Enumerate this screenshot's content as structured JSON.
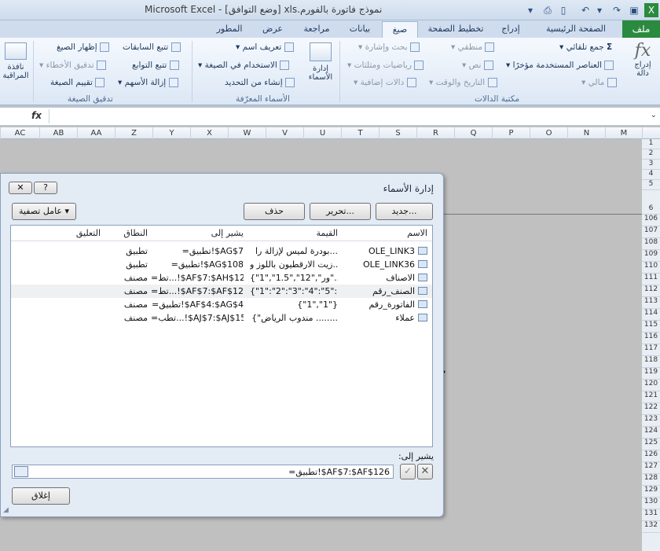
{
  "window": {
    "title": "نموذج فاتورة بالفورم.xls  [وضع التوافق] - Microsoft Excel"
  },
  "ribbon_tabs": [
    {
      "label": "ملف"
    },
    {
      "label": "الصفحة الرئيسية"
    },
    {
      "label": "إدراج"
    },
    {
      "label": "تخطيط الصفحة"
    },
    {
      "label": "صيغ"
    },
    {
      "label": "بيانات"
    },
    {
      "label": "مراجعة"
    },
    {
      "label": "عرض"
    },
    {
      "label": "المطور"
    }
  ],
  "ribbon": {
    "insert_function": "إدراج دالة",
    "autosum": "جمع تلقائي",
    "recently_used": "العناصر المستخدمة مؤخرًا",
    "financial": "مالي",
    "logical": "منطقي",
    "text": "نص",
    "date_time": "التاريخ والوقت",
    "lookup": "بحث وإشارة",
    "math_trig": "رياضيات ومثلثات",
    "more_functions": "دالات إضافية",
    "function_library": "مكتبة الدالات",
    "name_manager": "إدارة الأسماء",
    "define_name": "تعريف اسم",
    "use_in_formula": "الاستخدام في الصيغة",
    "create_from_selection": "إنشاء من التحديد",
    "defined_names": "الأسماء المعرّفة",
    "trace_precedents": "تتبع السابقات",
    "trace_dependents": "تتبع التوابع",
    "remove_arrows": "إزالة الأسهم",
    "show_formulas": "إظهار الصيغ",
    "error_checking": "تدقيق الأخطاء",
    "evaluate_formula": "تقييم الصيغة",
    "formula_auditing": "تدقيق الصيغة",
    "watch_window": "نافذة المراقبة"
  },
  "formula_bar": {
    "fx": "fx",
    "value": ""
  },
  "columns": [
    "AC",
    "AB",
    "AA",
    "Z",
    "Y",
    "X",
    "W",
    "V",
    "U",
    "T",
    "S",
    "R",
    "Q",
    "P",
    "O",
    "N",
    "M"
  ],
  "rows": [
    "1",
    "2",
    "3",
    "4",
    "5",
    "6",
    "106",
    "107",
    "108",
    "109",
    "110",
    "111",
    "112",
    "113",
    "114",
    "115",
    "116",
    "117",
    "118",
    "119",
    "120",
    "121",
    "122",
    "123",
    "124",
    "125",
    "126",
    "127",
    "128",
    "129",
    "130",
    "131",
    "132"
  ],
  "dialog": {
    "title": "إدارة الأسماء",
    "new_button": "جديد...",
    "edit_button": "تحرير...",
    "delete_button": "حذف",
    "filter_button": "عامل تصفية",
    "headers": {
      "name": "الاسم",
      "value": "القيمة",
      "refers_to": "يشير إلى",
      "scope": "النطاق",
      "comment": "التعليق"
    },
    "names": [
      {
        "name": "OLE_LINK3",
        "value": "بودرة لميس لإزالة را...",
        "refers_to": "=تطبيق!$AG$7",
        "scope": "تطبيق",
        "comment": ""
      },
      {
        "name": "OLE_LINK36",
        "value": "زيت الارقطيون باللوز و...",
        "refers_to": "=تطبيق!$AG$108",
        "scope": "تطبيق",
        "comment": ""
      },
      {
        "name": "الاصناف",
        "value": "{\"1\",\"ور\",\"12\",\"1.5\"...",
        "refers_to": "=تط...!$AF$7:$AH$126",
        "scope": "مصنف",
        "comment": ""
      },
      {
        "name": "الصنف_رقم",
        "value": "{\"1\":\"2\":\"3\":\"4\":\"5\":...",
        "refers_to": "=تط...!$AF$7:$AF$126",
        "scope": "مصنف",
        "comment": ""
      },
      {
        "name": "الفاتورة_رقم",
        "value": "{\"1\",\"1\"}",
        "refers_to": "=تطبيق!$AF$4:$AG$4",
        "scope": "مصنف",
        "comment": ""
      },
      {
        "name": "عملاء",
        "value": "{\"مندوب الرياض ........",
        "refers_to": "=تطب...!$AJ$7:$AJ$15",
        "scope": "مصنف",
        "comment": ""
      }
    ],
    "selected_index": 3,
    "refers_to_label": "يشير إلى:",
    "refers_to_value": "=تطبيق!$AF$7:$AF$126",
    "close_button": "إغلاق"
  }
}
